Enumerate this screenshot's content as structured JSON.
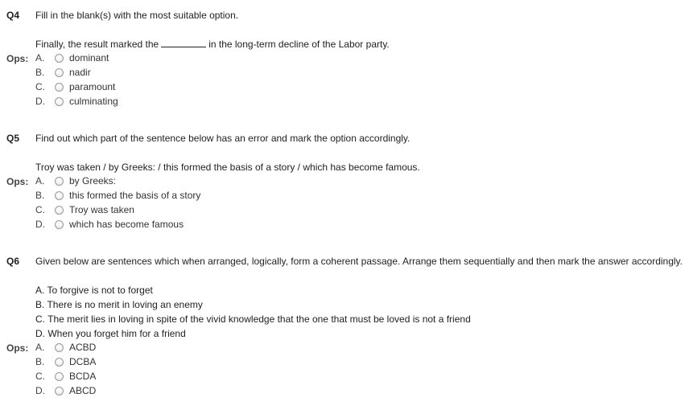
{
  "questions": [
    {
      "number": "Q4",
      "prompt": "Fill in the blank(s) with the most suitable option.",
      "sentence_before": "Finally, the result marked the",
      "sentence_after": "in the long-term decline of the Labor party.",
      "ops_label": "Ops:",
      "options": [
        {
          "letter": "A.",
          "text": "dominant"
        },
        {
          "letter": "B.",
          "text": "nadir"
        },
        {
          "letter": "C.",
          "text": "paramount"
        },
        {
          "letter": "D.",
          "text": "culminating"
        }
      ]
    },
    {
      "number": "Q5",
      "prompt": "Find out which part of the sentence below has an error and mark the option accordingly.",
      "sentence": "Troy was taken / by Greeks: / this formed the basis of a story / which has become famous.",
      "ops_label": "Ops:",
      "options": [
        {
          "letter": "A.",
          "text": "by Greeks:"
        },
        {
          "letter": "B.",
          "text": "this formed the basis of a story"
        },
        {
          "letter": "C.",
          "text": "Troy was taken"
        },
        {
          "letter": "D.",
          "text": "which has become famous"
        }
      ]
    },
    {
      "number": "Q6",
      "prompt": "Given below are sentences which when arranged, logically, form a coherent passage. Arrange them sequentially and then mark the answer accordingly.",
      "sentences": [
        "A. To forgive is not to forget",
        "B. There is no merit in loving an enemy",
        "C. The merit lies in loving in spite of the vivid knowledge that the one that must be loved is not a friend",
        "D. When you forget him for a friend"
      ],
      "ops_label": "Ops:",
      "options": [
        {
          "letter": "A.",
          "text": "ACBD"
        },
        {
          "letter": "B.",
          "text": "DCBA"
        },
        {
          "letter": "C.",
          "text": "BCDA"
        },
        {
          "letter": "D.",
          "text": "ABCD"
        }
      ]
    }
  ]
}
